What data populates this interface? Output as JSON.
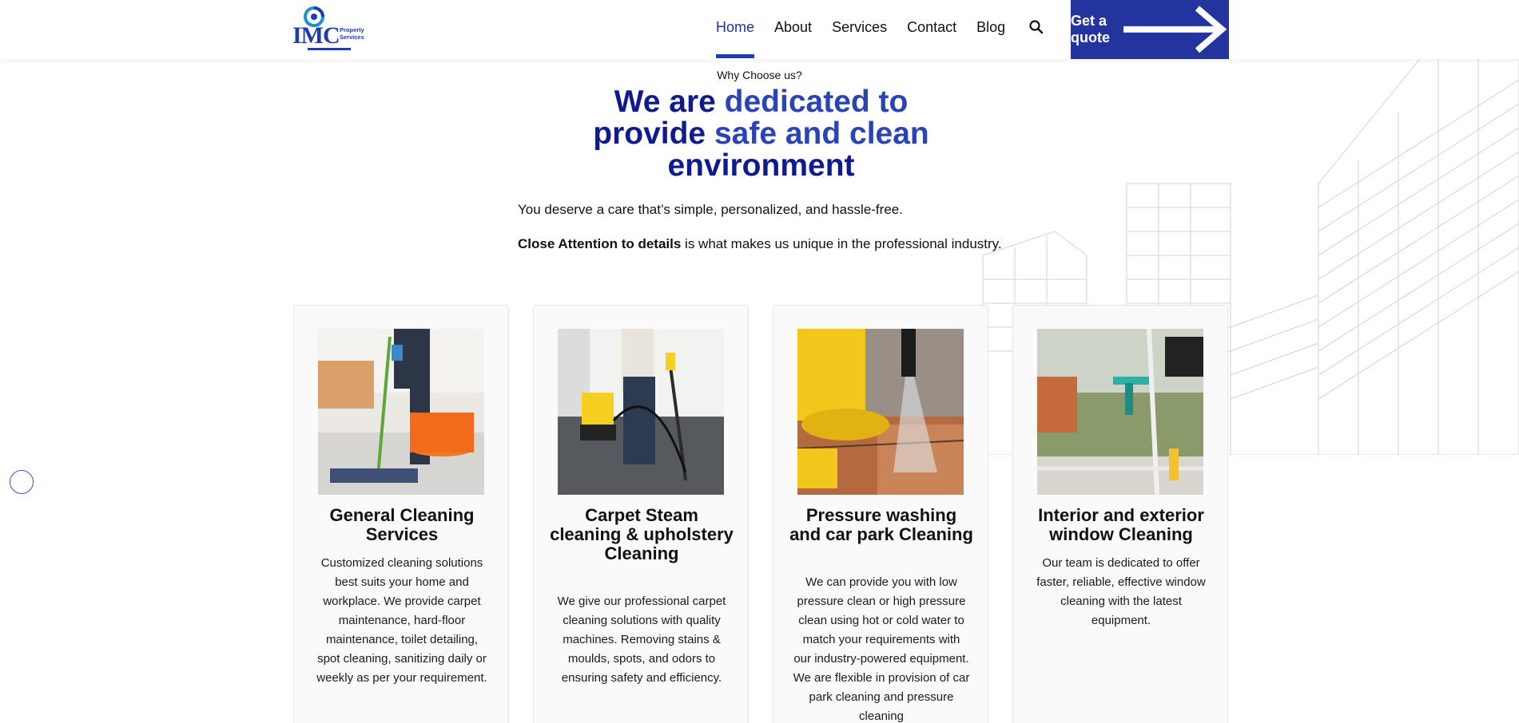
{
  "header": {
    "logo_text": "IMC",
    "logo_sub": "Property Services",
    "nav": [
      {
        "label": "Home",
        "active": true
      },
      {
        "label": "About"
      },
      {
        "label": "Services"
      },
      {
        "label": "Contact"
      },
      {
        "label": "Blog"
      }
    ],
    "search_icon": "search-icon",
    "quote_button": "Get a quote"
  },
  "hero": {
    "eyebrow": "Why Choose us?",
    "headline_part1": "We are ",
    "headline_part2": "dedicated to",
    "headline_part3": "provide ",
    "headline_part4": "safe and clean",
    "headline_part5": "environment",
    "intro": "You deserve a care that’s simple, personalized, and hassle-free.",
    "intro2_bold": "Close Attention to details",
    "intro2_rest": " is what makes us unique in the professional industry."
  },
  "cards": [
    {
      "title": "General Cleaning Services",
      "body": "Customized cleaning solutions best suits your home and workplace. We provide carpet maintenance, hard-floor maintenance, toilet detailing, spot cleaning, sanitizing daily or weekly as per your requirement."
    },
    {
      "title": "Carpet Steam cleaning & upholstery Cleaning",
      "body": "We give our professional carpet cleaning solutions with quality machines. Removing stains & moulds, spots, and odors to ensuring safety and efficiency."
    },
    {
      "title": "Pressure washing and car park Cleaning",
      "body": "We can provide you with low pressure clean or high pressure clean using hot or cold water to match your requirements with our industry-powered equipment. We are flexible in provision of car park cleaning and pressure cleaning"
    },
    {
      "title": "Interior and exterior window Cleaning",
      "body": "Our team is dedicated to offer faster, reliable, effective window cleaning with the latest equipment."
    }
  ],
  "colors": {
    "brand_blue": "#24349f",
    "headline_dark": "#0f1a8f",
    "headline_highlight": "#2a43b6"
  }
}
